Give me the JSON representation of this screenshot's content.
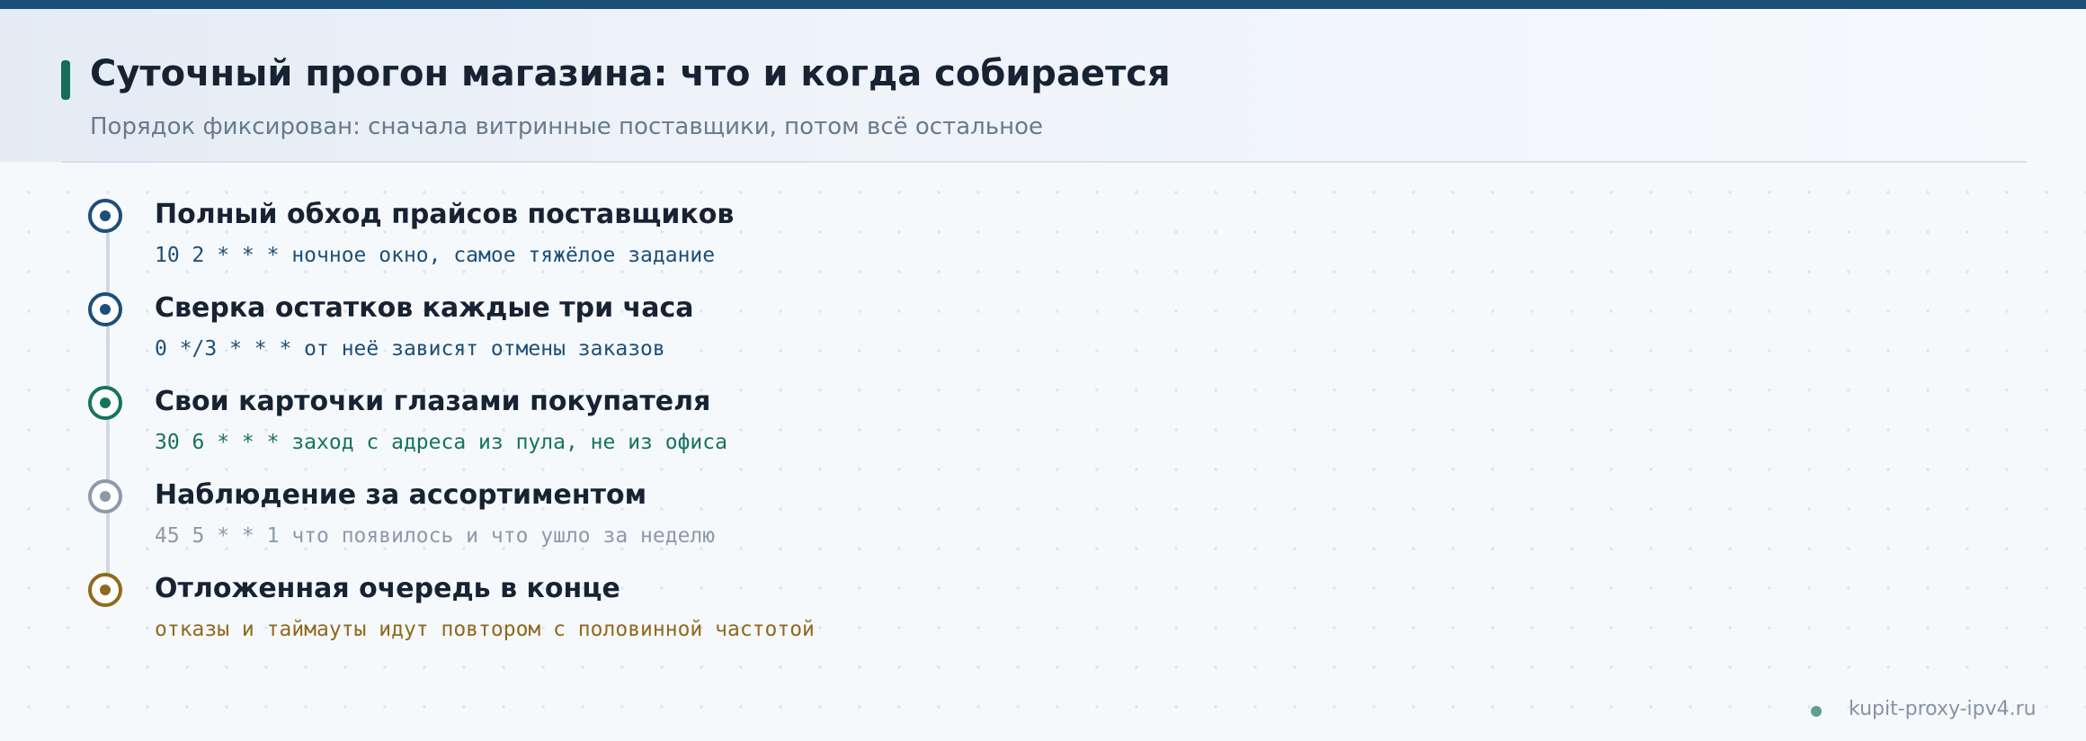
{
  "header": {
    "title": "Суточный прогон магазина: что и когда собирается",
    "subtitle": "Порядок фиксирован: сначала витринные поставщики, потом всё остальное"
  },
  "steps": [
    {
      "title": "Полный обход прайсов поставщиков",
      "detail": "10 2 * * * ночное окно, самое тяжёлое задание",
      "color": "#1c4f78"
    },
    {
      "title": "Сверка остатков каждые три часа",
      "detail": "0 */3 * * * от неё зависят отмены заказов",
      "color": "#1c4f78"
    },
    {
      "title": "Свои карточки глазами покупателя",
      "detail": "30 6 * * * заход с адреса из пула, не из офиса",
      "color": "#17735e"
    },
    {
      "title": "Наблюдение за ассортиментом",
      "detail": "45 5 * * 1 что появилось и что ушло за неделю",
      "color": "#8c9aab"
    },
    {
      "title": "Отложенная очередь в конце",
      "detail": "отказы и таймауты идут повтором с половинной частотой",
      "color": "#8f6a1c"
    }
  ],
  "footer": {
    "site": "kupit-proxy-ipv4.ru"
  },
  "colors": {
    "top_bar": "#1a5078",
    "accent": "#156d57",
    "title_text": "#172233",
    "footer_dot": "#5f9e94"
  }
}
